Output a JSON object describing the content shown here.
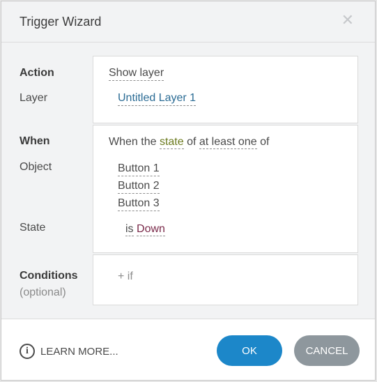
{
  "dialog": {
    "title": "Trigger Wizard",
    "close_glyph": "✕"
  },
  "action": {
    "section_label": "Action",
    "action_value": "Show layer",
    "layer_label": "Layer",
    "layer_value": "Untitled Layer 1"
  },
  "when": {
    "section_label": "When",
    "sentence": {
      "prefix": "When the",
      "state_link": "state",
      "of_word": "of",
      "quantifier_link": "at least one",
      "suffix": "of"
    },
    "object_label": "Object",
    "objects": [
      "Button 1",
      "Button 2",
      "Button 3"
    ],
    "state_label": "State",
    "state_is": "is",
    "state_value": "Down"
  },
  "conditions": {
    "section_label": "Conditions",
    "section_sublabel": "(optional)",
    "add_if": "+ if"
  },
  "footer": {
    "learn_more": "LEARN MORE...",
    "ok": "OK",
    "cancel": "CANCEL"
  },
  "colors": {
    "accent_blue": "#1c87c9",
    "cancel_grey": "#8e979d",
    "link_blue": "#2a6b94",
    "state_olive": "#6b7a1e",
    "value_maroon": "#7a2a4a"
  },
  "icons": {
    "close": "close-icon",
    "info": "info-icon"
  }
}
